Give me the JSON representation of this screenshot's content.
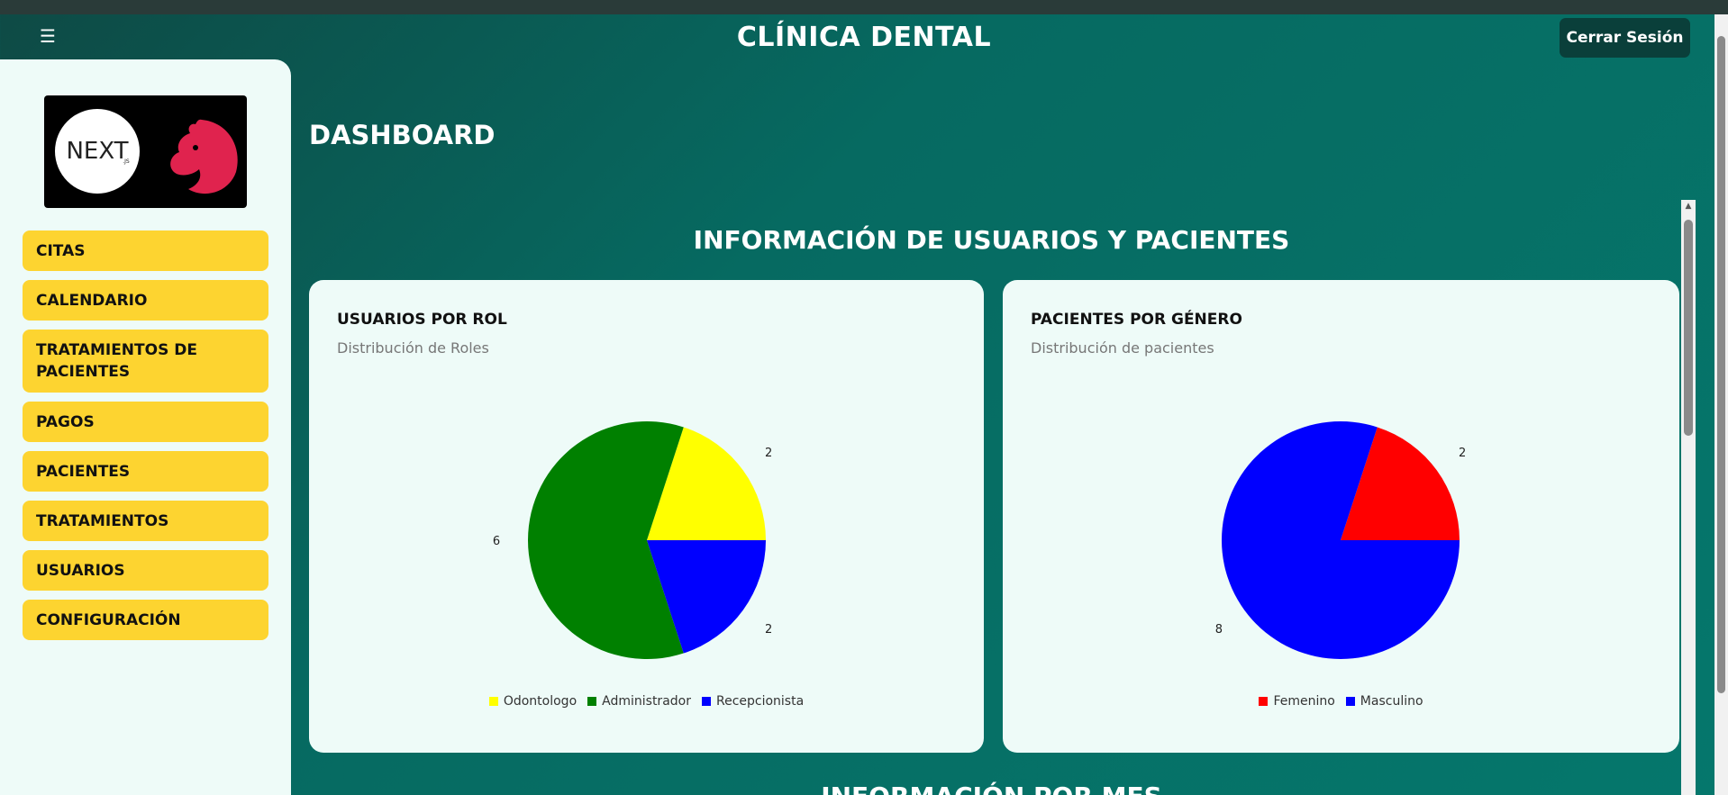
{
  "app": {
    "title": "CLÍNICA DENTAL",
    "logout_label": "Cerrar Sesión"
  },
  "sidebar": {
    "items": [
      {
        "label": "CITAS"
      },
      {
        "label": "CALENDARIO"
      },
      {
        "label": "TRATAMIENTOS DE PACIENTES"
      },
      {
        "label": "PAGOS"
      },
      {
        "label": "PACIENTES"
      },
      {
        "label": "TRATAMIENTOS"
      },
      {
        "label": "USUARIOS"
      },
      {
        "label": "CONFIGURACIÓN"
      }
    ]
  },
  "main": {
    "title": "DASHBOARD",
    "section_title": "INFORMACIÓN DE USUARIOS Y PACIENTES",
    "next_section_title": "INFORMACIÓN POR MES"
  },
  "colors": {
    "accent": "#fdd430",
    "header": "#066a61",
    "yellow": "#ffff00",
    "green": "#008000",
    "blue": "#0000ff",
    "red": "#ff0000"
  },
  "chart_data": [
    {
      "type": "pie",
      "title": "USUARIOS POR ROL",
      "subtitle": "Distribución de Roles",
      "categories": [
        "Odontologo",
        "Administrador",
        "Recepcionista"
      ],
      "values": [
        2,
        6,
        2
      ],
      "colors": [
        "#ffff00",
        "#008000",
        "#0000ff"
      ],
      "legend": "bottom"
    },
    {
      "type": "pie",
      "title": "PACIENTES POR GÉNERO",
      "subtitle": "Distribución de pacientes",
      "categories": [
        "Femenino",
        "Masculino"
      ],
      "values": [
        2,
        8
      ],
      "colors": [
        "#ff0000",
        "#0000ff"
      ],
      "legend": "bottom"
    }
  ]
}
